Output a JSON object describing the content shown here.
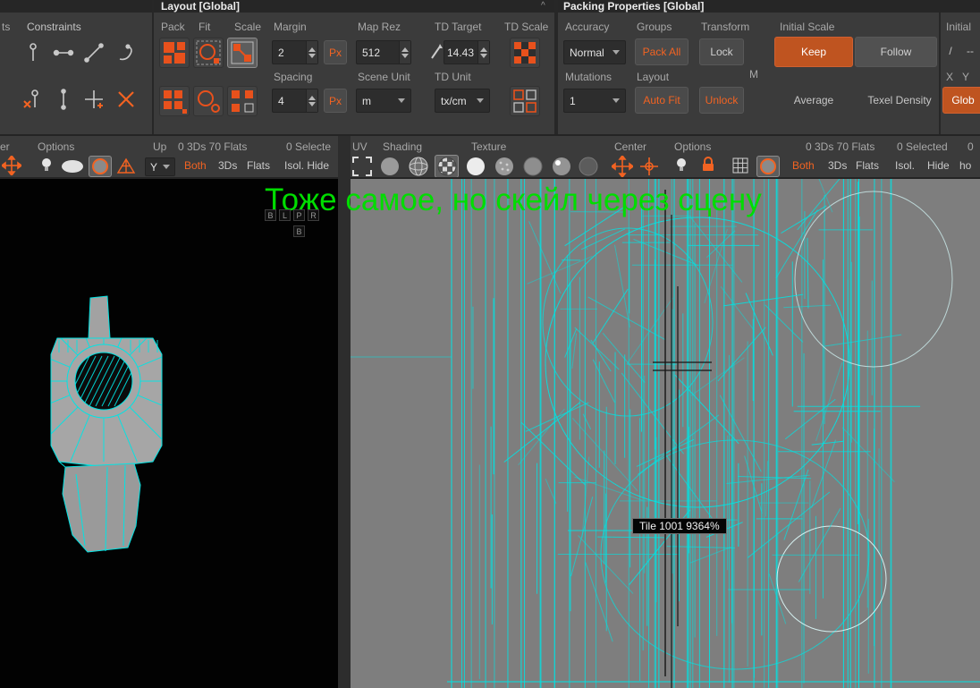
{
  "top": {
    "constraints_tab_fragment": "ts",
    "constraints_title": "Constraints",
    "layout_title": "Layout [Global]",
    "packing_title": "Packing Properties [Global]",
    "collapse_arrow": "^"
  },
  "layout": {
    "pack_label": "Pack",
    "fit_label": "Fit",
    "scale_label": "Scale",
    "margin_label": "Margin",
    "map_rez_label": "Map Rez",
    "td_target_label": "TD Target",
    "td_scale_label": "TD Scale",
    "spacing_label": "Spacing",
    "scene_unit_label": "Scene Unit",
    "td_unit_label": "TD Unit",
    "margin_value": "2",
    "margin_px": "Px",
    "map_rez_value": "512",
    "td_target_value": "14.43",
    "spacing_value": "4",
    "spacing_px": "Px",
    "scene_unit_value": "m",
    "td_unit_value": "tx/cm"
  },
  "packing": {
    "accuracy_label": "Accuracy",
    "groups_label": "Groups",
    "transform_label": "Transform",
    "initial_scale_label": "Initial Scale",
    "initial_fragment": "Initial",
    "mutations_label": "Mutations",
    "layout_label": "Layout",
    "m_fragment": "M",
    "accuracy_value": "Normal",
    "pack_all": "Pack All",
    "lock": "Lock",
    "keep": "Keep",
    "follow": "Follow",
    "mutations_value": "1",
    "auto_fit": "Auto Fit",
    "unlock": "Unlock",
    "average": "Average",
    "texel_density": "Texel Density",
    "slash": "/",
    "dashes": "--",
    "x": "X",
    "y": "Y",
    "glob_fragment": "Glob"
  },
  "vp3d": {
    "fragment": "er",
    "options": "Options",
    "up": "Up",
    "axis": "Y",
    "counts": "0 3Ds 70 Flats",
    "selected": "0 Selecte",
    "both": "Both",
    "tds": "3Ds",
    "flats": "Flats",
    "isol_hide": "Isol. Hide"
  },
  "vpuv": {
    "uv": "UV",
    "shading": "Shading",
    "texture": "Texture",
    "center": "Center",
    "options": "Options",
    "counts": "0 3Ds 70 Flats",
    "selected": "0 Selected",
    "zero": "0",
    "both": "Both",
    "tds": "3Ds",
    "flats": "Flats",
    "isol": "Isol.",
    "hide": "Hide",
    "fragment": "ho"
  },
  "overlay": {
    "annotation": "Тоже самое, но скейл через сцену",
    "keys": [
      "B",
      "L",
      "P",
      "R"
    ],
    "key2": "B",
    "tooltip": "Tile 1001 9364%"
  },
  "colors": {
    "accent": "#f26322",
    "wire": "#00e4e4",
    "annotation_green": "#00dd00",
    "uv_background": "#7e7e7e"
  }
}
